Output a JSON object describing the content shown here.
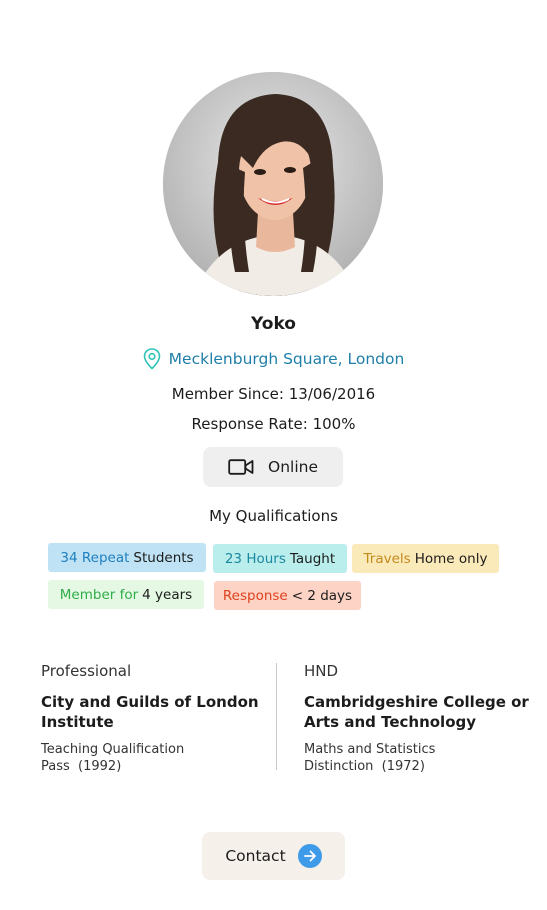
{
  "profile": {
    "name": "Yoko",
    "location": "Mecklenburgh Square, London",
    "member_since_label": "Member Since:",
    "member_since_value": "13/06/2016",
    "response_rate_label": "Response Rate:",
    "response_rate_value": "100%",
    "online_label": "Online"
  },
  "qualifications": {
    "title": "My Qualifications",
    "chips": [
      {
        "highlight": "34 Repeat",
        "text": "Students"
      },
      {
        "highlight": "23 Hours",
        "text": "Taught"
      },
      {
        "highlight": "Travels",
        "text": "Home only"
      },
      {
        "highlight": "Member for",
        "text": "4 years"
      },
      {
        "highlight": "Response",
        "text": "< 2 days"
      }
    ]
  },
  "education": [
    {
      "level": "Professional",
      "institution": "City and Guilds of London Institute",
      "course": "Teaching Qualification",
      "result": "Pass  (1992)"
    },
    {
      "level": "HND",
      "institution": "Cambridgeshire College or Arts and Technology",
      "course": "Maths and Statistics",
      "result": "Distinction  (1972)"
    }
  ],
  "contact": {
    "label": "Contact"
  },
  "icons": {
    "location": "map-pin-icon",
    "online": "video-camera-icon",
    "contact": "arrow-right-icon"
  },
  "colors": {
    "link_blue": "#1f7fa8",
    "pin_teal": "#2ec4b6",
    "contact_arrow": "#3d9be9"
  }
}
